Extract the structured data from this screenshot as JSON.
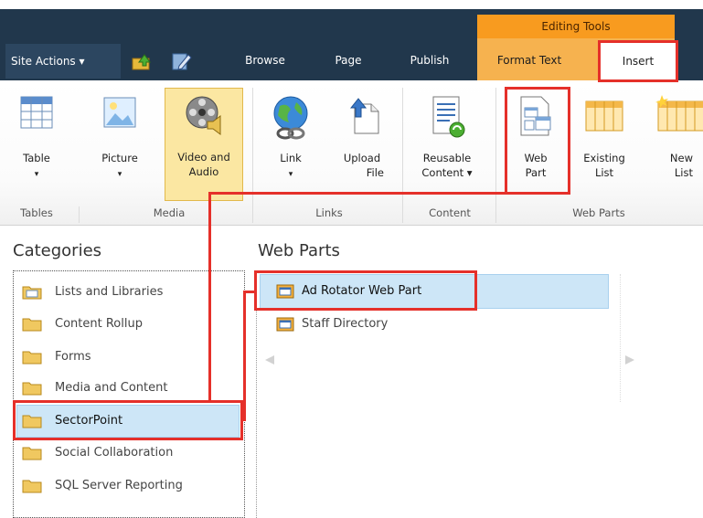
{
  "topbar": {
    "site_actions": "Site Actions ▾",
    "tabs": [
      "Browse",
      "Page",
      "Publish"
    ],
    "context_group": "Editing Tools",
    "context_tabs": [
      "Format Text",
      "Insert"
    ],
    "active_tab": "Insert"
  },
  "ribbon": {
    "buttons": {
      "table": "Table",
      "picture": "Picture",
      "video_audio_1": "Video and",
      "video_audio_2": "Audio",
      "link": "Link",
      "upload_file_1": "Upload",
      "upload_file_2": "File",
      "reusable_content_1": "Reusable",
      "reusable_content_2": "Content ▾",
      "web_part_1": "Web",
      "web_part_2": "Part",
      "existing_list_1": "Existing",
      "existing_list_2": "List",
      "new_list_1": "New",
      "new_list_2": "List"
    },
    "groups": [
      "Tables",
      "Media",
      "Links",
      "Content",
      "Web Parts"
    ],
    "dropdown_arrow": "▾"
  },
  "panel": {
    "categories_title": "Categories",
    "web_parts_title": "Web Parts",
    "categories": [
      "Lists and Libraries",
      "Content Rollup",
      "Forms",
      "Media and Content",
      "SectorPoint",
      "Social Collaboration",
      "SQL Server Reporting"
    ],
    "selected_category": "SectorPoint",
    "web_parts": [
      "Ad Rotator Web Part",
      "Staff Directory"
    ],
    "selected_web_part": "Ad Rotator Web Part"
  },
  "colors": {
    "ribbon_bar": "#21374c",
    "context_orange": "#f89b1f",
    "highlight_red": "#e5302a",
    "selection_blue": "#cde6f7"
  }
}
